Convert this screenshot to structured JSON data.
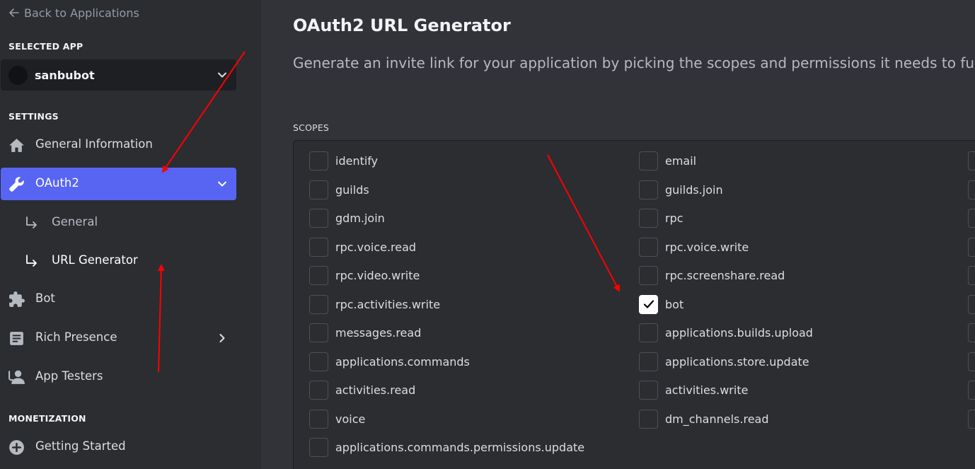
{
  "sidebar": {
    "back_label": "Back to Applications",
    "selected_app_heading": "SELECTED APP",
    "selected_app_name": "sanbubot",
    "settings_heading": "SETTINGS",
    "items": [
      {
        "label": "General Information",
        "icon": "home-icon"
      },
      {
        "label": "OAuth2",
        "icon": "wrench-icon",
        "active": true
      },
      {
        "label": "General",
        "icon": "sub-arrow-icon"
      },
      {
        "label": "URL Generator",
        "icon": "sub-arrow-icon",
        "current": true
      },
      {
        "label": "Bot",
        "icon": "puzzle-icon"
      },
      {
        "label": "Rich Presence",
        "icon": "document-icon"
      },
      {
        "label": "App Testers",
        "icon": "user-icon"
      }
    ],
    "monetization_heading": "MONETIZATION",
    "monetization_items": [
      {
        "label": "Getting Started",
        "icon": "plus-circle-icon"
      }
    ]
  },
  "main": {
    "title": "OAuth2 URL Generator",
    "description": "Generate an invite link for your application by picking the scopes and permissions it needs to function.",
    "scopes_heading": "SCOPES",
    "scopes_col1": [
      {
        "label": "identify",
        "checked": false
      },
      {
        "label": "guilds",
        "checked": false
      },
      {
        "label": "gdm.join",
        "checked": false
      },
      {
        "label": "rpc.voice.read",
        "checked": false
      },
      {
        "label": "rpc.video.write",
        "checked": false
      },
      {
        "label": "rpc.activities.write",
        "checked": false
      },
      {
        "label": "messages.read",
        "checked": false
      },
      {
        "label": "applications.commands",
        "checked": false
      },
      {
        "label": "activities.read",
        "checked": false
      },
      {
        "label": "voice",
        "checked": false
      },
      {
        "label": "applications.commands.permissions.update",
        "checked": false
      }
    ],
    "scopes_col2": [
      {
        "label": "email",
        "checked": false
      },
      {
        "label": "guilds.join",
        "checked": false
      },
      {
        "label": "rpc",
        "checked": false
      },
      {
        "label": "rpc.voice.write",
        "checked": false
      },
      {
        "label": "rpc.screenshare.read",
        "checked": false
      },
      {
        "label": "bot",
        "checked": true
      },
      {
        "label": "applications.builds.upload",
        "checked": false
      },
      {
        "label": "applications.store.update",
        "checked": false
      },
      {
        "label": "activities.write",
        "checked": false
      },
      {
        "label": "dm_channels.read",
        "checked": false
      }
    ]
  },
  "colors": {
    "accent": "#5865f2",
    "annotation": "#ff0000",
    "background": "#313338",
    "sidebar": "#2b2d31"
  }
}
